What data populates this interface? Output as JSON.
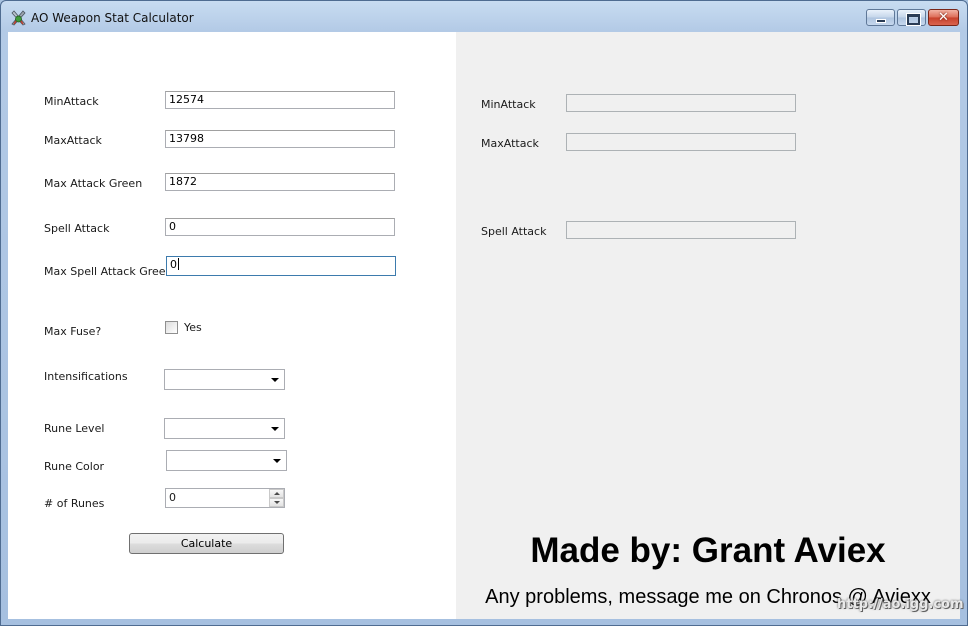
{
  "window": {
    "title": "AO Weapon Stat Calculator",
    "icon": "app-sword-icon"
  },
  "caption_buttons": {
    "minimize": "minimize-icon",
    "maximize": "maximize-icon",
    "close": "close-icon"
  },
  "form": {
    "min_attack": {
      "label": "MinAttack",
      "value": "12574"
    },
    "max_attack": {
      "label": "MaxAttack",
      "value": "13798"
    },
    "max_attack_green": {
      "label": "Max Attack Green",
      "value": "1872"
    },
    "spell_attack": {
      "label": "Spell Attack",
      "value": "0"
    },
    "max_spell_attack_green": {
      "label": "Max Spell Attack Green",
      "value": "0"
    },
    "max_fuse": {
      "label": "Max Fuse?",
      "checkbox_label": "Yes",
      "checked": false
    },
    "intensifications": {
      "label": "Intensifications",
      "value": ""
    },
    "rune_level": {
      "label": "Rune Level",
      "value": ""
    },
    "rune_color": {
      "label": "Rune Color",
      "value": ""
    },
    "num_runes": {
      "label": "# of Runes",
      "value": "0"
    },
    "calculate_button": "Calculate"
  },
  "results": {
    "min_attack": {
      "label": "MinAttack",
      "value": ""
    },
    "max_attack": {
      "label": "MaxAttack",
      "value": ""
    },
    "spell_attack": {
      "label": "Spell Attack",
      "value": ""
    }
  },
  "credits": {
    "made_by": "Made by: Grant Aviex",
    "contact": "Any problems, message me on Chronos @ Aviexx"
  },
  "watermark": "http://ao.igg.com",
  "colors": {
    "title_bar": "#b3cae6",
    "close_button": "#c8412b",
    "left_panel": "#ffffff",
    "right_panel": "#f0f0f0"
  }
}
